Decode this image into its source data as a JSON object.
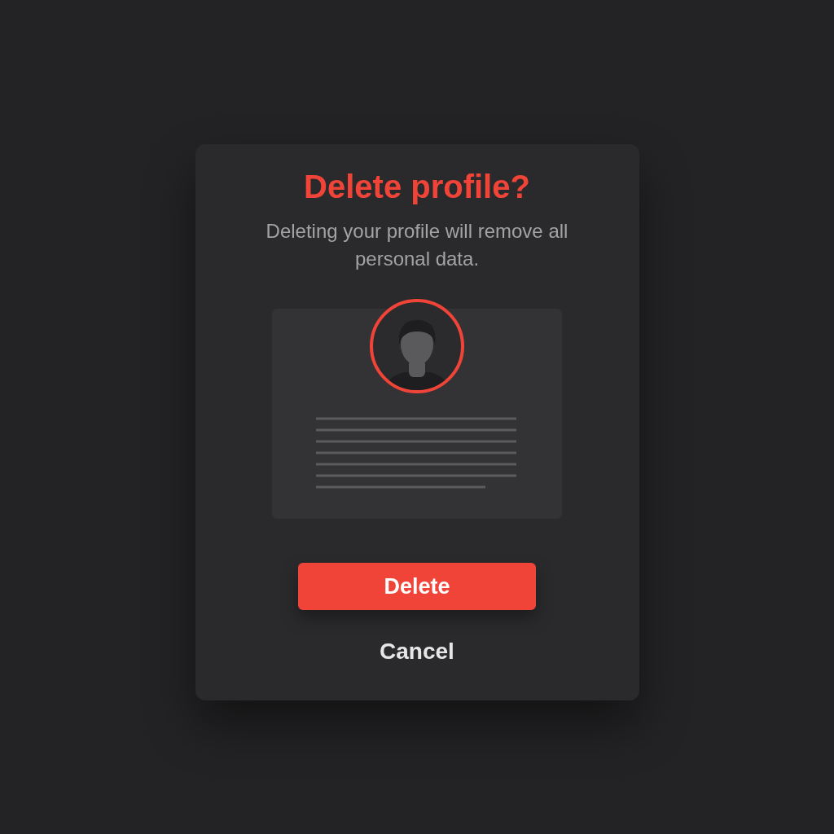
{
  "dialog": {
    "title": "Delete profile?",
    "message": "Deleting your profile will remove all personal data.",
    "buttons": [
      {
        "kind": "primary",
        "label": "Delete"
      },
      {
        "kind": "text",
        "label": "Cancel"
      }
    ]
  }
}
